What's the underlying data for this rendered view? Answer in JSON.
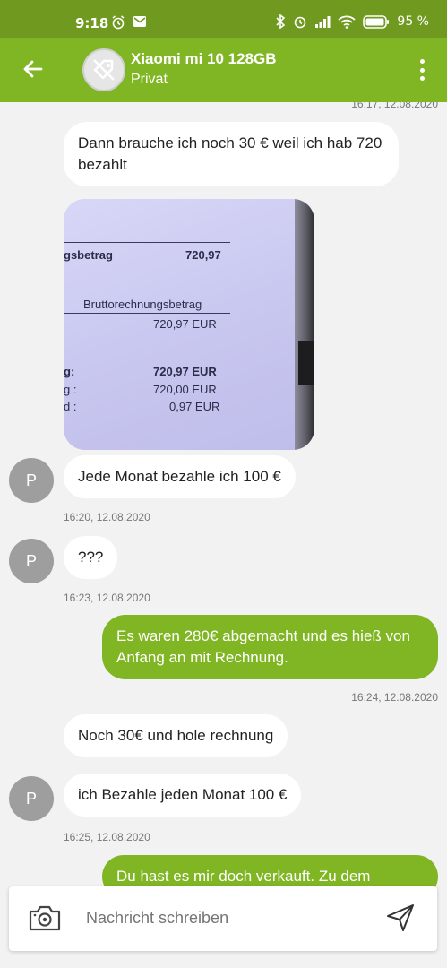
{
  "statusbar": {
    "time": "9:18",
    "battery": "95 %"
  },
  "header": {
    "title": "Xiaomi mi 10 128GB",
    "subtitle": "Privat"
  },
  "messages": [
    {
      "kind": "timestamp",
      "text": "16:17, 12.08.2020"
    },
    {
      "kind": "in",
      "text": "Dann brauche ich noch 30 € weil ich hab 720 bezahlt"
    },
    {
      "kind": "in-image",
      "receipt": {
        "line1_label": "gsbetrag",
        "line1_value": "720,97",
        "line2_label": "Bruttorechnungsbetrag",
        "line2_value": "720,97 EUR",
        "row1_label": "g:",
        "row1_value": "720,97 EUR",
        "row2_label": "g :",
        "row2_value": "720,00 EUR",
        "row3_label": "d :",
        "row3_value": "0,97 EUR"
      }
    },
    {
      "kind": "in",
      "text": "Jede Monat bezahle ich 100 €",
      "avatar": "P",
      "time": "16:20, 12.08.2020"
    },
    {
      "kind": "in",
      "text": "???",
      "avatar": "P",
      "time": "16:23, 12.08.2020"
    },
    {
      "kind": "out",
      "text": "Es waren 280€ abgemacht und es hieß von Anfang an mit Rechnung.",
      "time": "16:24, 12.08.2020"
    },
    {
      "kind": "in",
      "text": "Noch 30€ und hole rechnung"
    },
    {
      "kind": "in",
      "text": "ich Bezahle jeden Monat 100 €",
      "avatar": "P",
      "time": "16:25, 12.08.2020"
    },
    {
      "kind": "out",
      "text": "Du hast es mir doch verkauft. Zu dem"
    }
  ],
  "composer": {
    "placeholder": "Nachricht schreiben"
  },
  "icons": {
    "back": "arrow-left-icon",
    "product": "tag-off-icon",
    "menu": "more-vert-icon",
    "camera": "camera-icon",
    "send": "send-icon"
  },
  "colors": {
    "statusbar": "#6f9a1f",
    "appbar": "#80b524",
    "outgoing": "#80b524",
    "incoming": "#ffffff",
    "background": "#f2f2f2"
  }
}
